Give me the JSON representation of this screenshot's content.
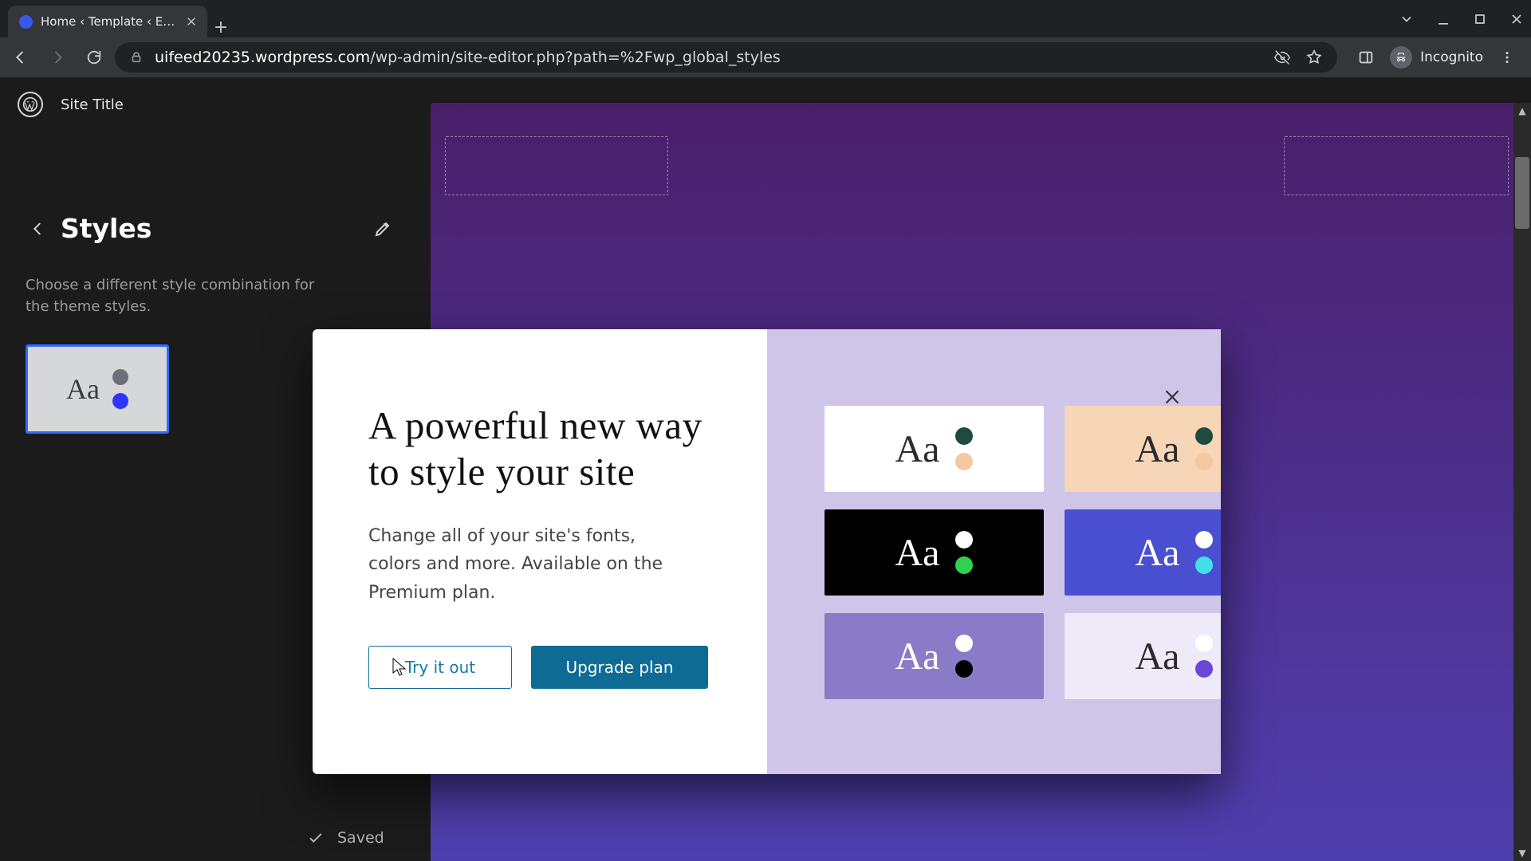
{
  "browser": {
    "tab_title": "Home ‹ Template ‹ Editor ‹ Site T",
    "url_domain": "uifeed20235.wordpress.com",
    "url_path": "/wp-admin/site-editor.php?path=%2Fwp_global_styles",
    "profile_label": "Incognito"
  },
  "header": {
    "site_title": "Site Title"
  },
  "sidebar": {
    "title": "Styles",
    "description": "Choose a different style combination for the theme styles.",
    "saved_label": "Saved",
    "variation": {
      "sample": "Aa",
      "dot1": "#6e6e78",
      "dot2": "#2f35ff"
    }
  },
  "modal": {
    "title": "A powerful new way to style your site",
    "body": "Change all of your site's fonts, colors and more. Available on the Premium plan.",
    "try_label": "Try it out",
    "upgrade_label": "Upgrade plan",
    "tiles": [
      {
        "bg": "#ffffff",
        "fg": "#2b2b2b",
        "d1": "#1f4a3f",
        "d2": "#f4c9a0"
      },
      {
        "bg": "#f6d6b6",
        "fg": "#2b2b2b",
        "d1": "#1f4a3f",
        "d2": "#f4c9a0"
      },
      {
        "bg": "#000000",
        "fg": "#ffffff",
        "d1": "#ffffff",
        "d2": "#2fd24f"
      },
      {
        "bg": "#4a4fd1",
        "fg": "#ffffff",
        "d1": "#ffffff",
        "d2": "#3fe0e8"
      },
      {
        "bg": "#8a7bc8",
        "fg": "#ffffff",
        "d1": "#ffffff",
        "d2": "#000000"
      },
      {
        "bg": "#efeaf7",
        "fg": "#2b2b2b",
        "d1": "#ffffff",
        "d2": "#6a47d6"
      }
    ],
    "tile_sample": "Aa"
  }
}
